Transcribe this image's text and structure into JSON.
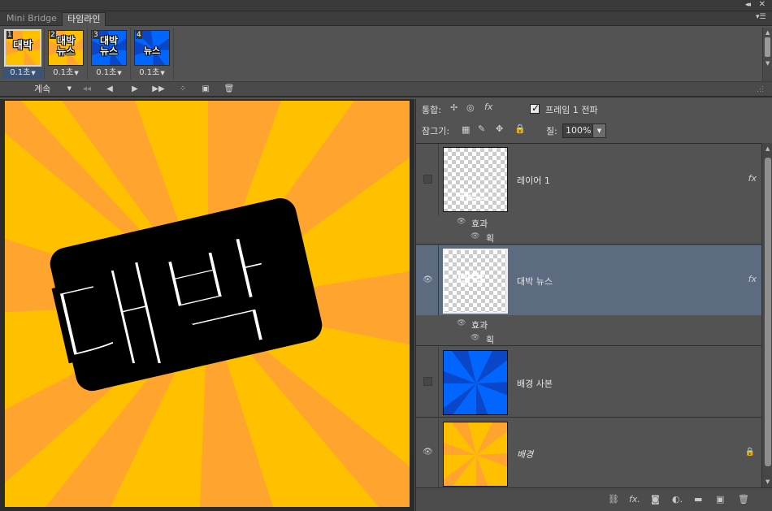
{
  "top": {
    "collapse_icon": "double-chevron-icon",
    "close_icon": "close-icon"
  },
  "tabs": [
    {
      "label": "Mini Bridge"
    },
    {
      "label": "타임라인"
    }
  ],
  "frames": [
    {
      "num": "1",
      "delay": "0.1초",
      "thumb_text": "대박",
      "bg": "#ffb300"
    },
    {
      "num": "2",
      "delay": "0.1초",
      "thumb_text": "대박\n뉴스",
      "bg": "#ffb300"
    },
    {
      "num": "3",
      "delay": "0.1초",
      "thumb_text": "대박\n뉴스",
      "bg": "#0052e8"
    },
    {
      "num": "4",
      "delay": "0.1초",
      "thumb_text": "뉴스",
      "bg": "#0052e8"
    }
  ],
  "timeline_controls": {
    "loop": "계속"
  },
  "canvas": {
    "headline": "대박",
    "ray_color_a": "#ffc000",
    "ray_color_b": "#ffa42e"
  },
  "layers_panel": {
    "unify_label": "통합:",
    "propagate_label": "프레임 1 전파",
    "lock_label": "잠그기:",
    "fill_label": "칠:",
    "fill_value": "100%"
  },
  "layers": [
    {
      "name": "레이어 1",
      "visible": false,
      "fx": "fx",
      "effects_label": "효과",
      "effect": "획"
    },
    {
      "name": "대박 뉴스",
      "visible": true,
      "fx": "fx",
      "effects_label": "효과",
      "effect": "획"
    },
    {
      "name": "배경 사본",
      "visible": false
    },
    {
      "name": "배경",
      "visible": true,
      "locked": true
    }
  ],
  "colors": {
    "selected_layer": "#5d6b80",
    "panel": "#535353",
    "blue": "#0052e8"
  }
}
